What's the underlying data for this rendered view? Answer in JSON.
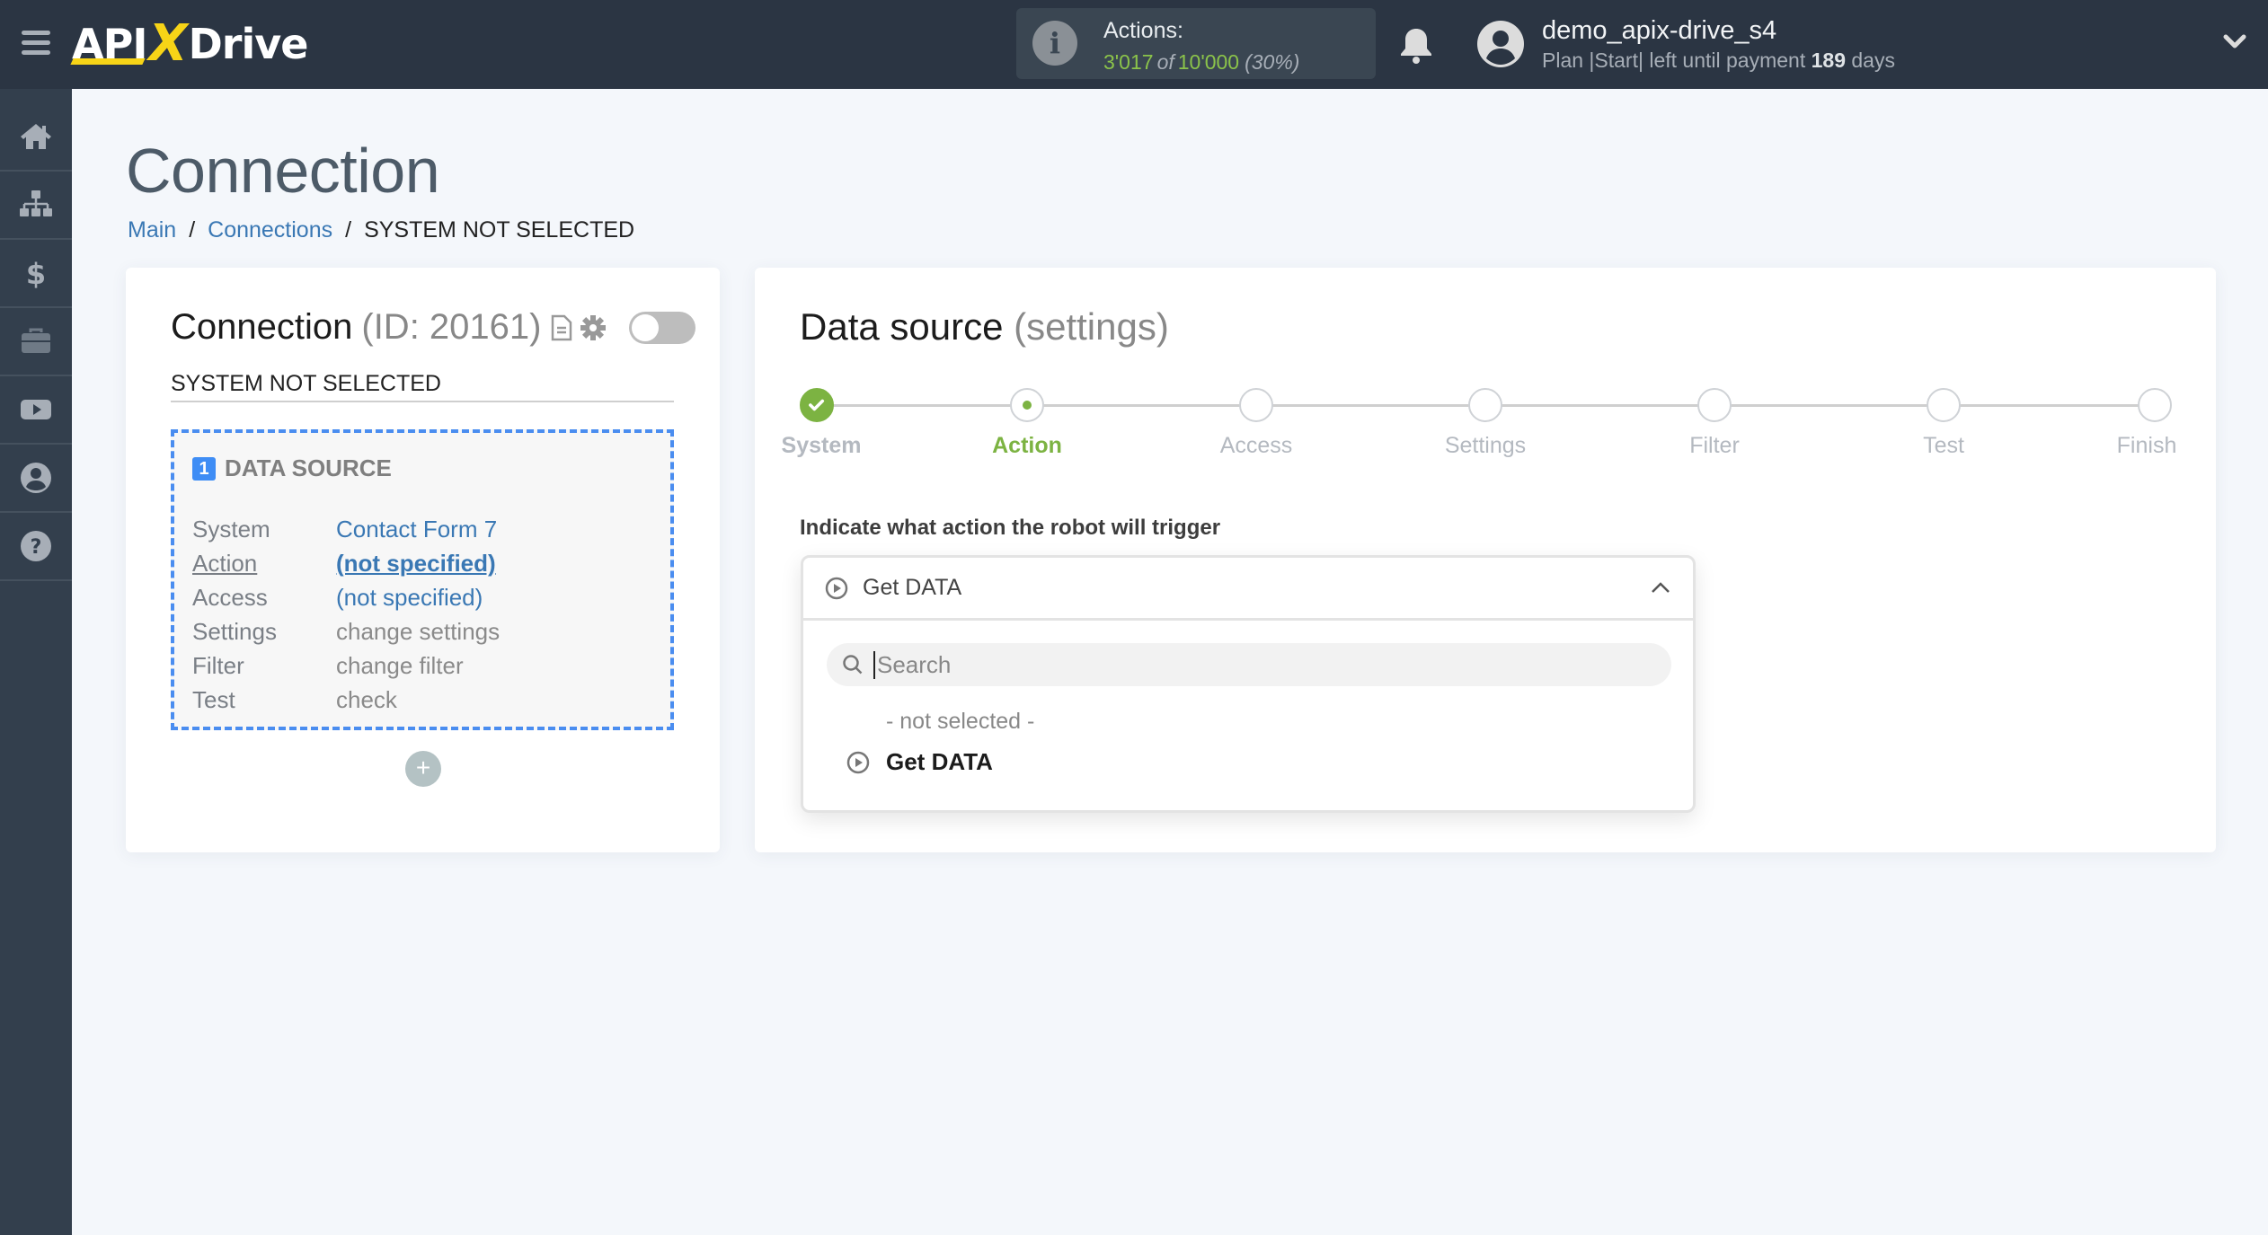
{
  "header": {
    "logo": {
      "left": "API",
      "x": "X",
      "right": "Drive"
    },
    "actions": {
      "label": "Actions:",
      "used": "3'017",
      "of": "of",
      "total": "10'000",
      "percent": "(30%)"
    },
    "user": {
      "name": "demo_apix-drive_s4",
      "plan_prefix": "Plan |Start| left until payment",
      "days": "189",
      "days_suffix": "days"
    }
  },
  "sidebar": {
    "items": [
      {
        "icon": "home-icon"
      },
      {
        "icon": "sitemap-icon"
      },
      {
        "icon": "dollar-icon"
      },
      {
        "icon": "briefcase-icon"
      },
      {
        "icon": "youtube-icon"
      },
      {
        "icon": "user-circle-icon"
      },
      {
        "icon": "help-icon"
      }
    ]
  },
  "page": {
    "title": "Connection",
    "breadcrumb": [
      {
        "label": "Main"
      },
      {
        "label": "Connections"
      },
      {
        "label": "SYSTEM NOT SELECTED"
      }
    ],
    "separator": "/"
  },
  "connection": {
    "title": "Connection",
    "id_label": "(ID: 20161)",
    "system_name": "SYSTEM NOT SELECTED",
    "enabled": false,
    "data_source": {
      "number": "1",
      "title": "DATA SOURCE",
      "rows": [
        {
          "key": "System",
          "value": "Contact Form 7"
        },
        {
          "key": "Action",
          "value": "(not specified)"
        },
        {
          "key": "Access",
          "value": "(not specified)"
        },
        {
          "key": "Settings",
          "value": "change settings"
        },
        {
          "key": "Filter",
          "value": "change filter"
        },
        {
          "key": "Test",
          "value": "check"
        }
      ]
    },
    "add_label": "+"
  },
  "settings": {
    "title": "Data source",
    "subtitle": "(settings)",
    "steps": [
      {
        "label": "System",
        "state": "done"
      },
      {
        "label": "Action",
        "state": "active"
      },
      {
        "label": "Access",
        "state": "pending"
      },
      {
        "label": "Settings",
        "state": "pending"
      },
      {
        "label": "Filter",
        "state": "pending"
      },
      {
        "label": "Test",
        "state": "pending"
      },
      {
        "label": "Finish",
        "state": "pending"
      }
    ],
    "field_label": "Indicate what action the robot will trigger",
    "dropdown": {
      "selected": "Get DATA",
      "search_placeholder": "Search",
      "search_value": "",
      "options": [
        {
          "label": "- not selected -"
        },
        {
          "label": "Get DATA"
        }
      ]
    }
  },
  "colors": {
    "topbar": "#2b3543",
    "sidebar": "#333f4d",
    "accent_green": "#7cb342",
    "link_blue": "#3a78b4",
    "dashed_blue": "#4a8df0",
    "logo_yellow": "#f7d417"
  }
}
